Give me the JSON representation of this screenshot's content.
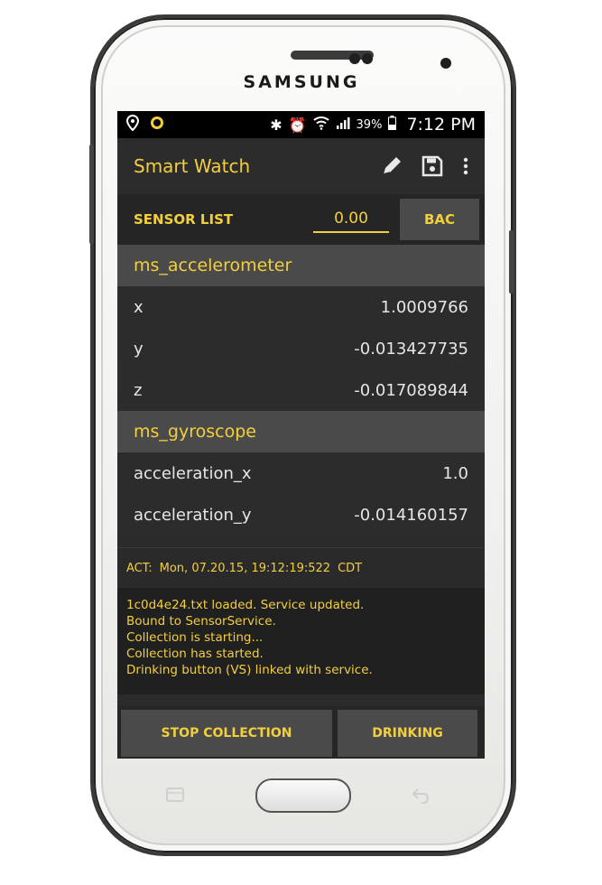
{
  "device": {
    "brand": "SAMSUNG"
  },
  "statusbar": {
    "battery": "39%",
    "time": "7:12 PM"
  },
  "appbar": {
    "title": "Smart Watch",
    "icons": [
      "pencil-icon",
      "save-icon",
      "overflow-menu-icon"
    ]
  },
  "sensor_bar": {
    "label": "SENSOR LIST",
    "bac_value": "0.00",
    "bac_button": "BAC"
  },
  "sensors": [
    {
      "name": "ms_accelerometer",
      "readings": [
        {
          "key": "x",
          "value": "1.0009766"
        },
        {
          "key": "y",
          "value": "-0.013427735"
        },
        {
          "key": "z",
          "value": "-0.017089844"
        }
      ]
    },
    {
      "name": "ms_gyroscope",
      "readings": [
        {
          "key": "acceleration_x",
          "value": "1.0"
        },
        {
          "key": "acceleration_y",
          "value": "-0.014160157"
        }
      ]
    }
  ],
  "act": {
    "label": "ACT:",
    "datetime": "Mon, 07.20.15, 19:12:19:522",
    "tz": "CDT"
  },
  "log": [
    "1c0d4e24.txt loaded. Service updated.",
    "Bound to SensorService.",
    "Collection is starting...",
    "Collection has started.",
    "Drinking button (VS) linked with service."
  ],
  "bottom_buttons": {
    "stop": "STOP COLLECTION",
    "drinking": "DRINKING"
  },
  "colors": {
    "accent": "#f3cf3e",
    "background": "#2b2b2b",
    "header": "#4a4a4a"
  }
}
